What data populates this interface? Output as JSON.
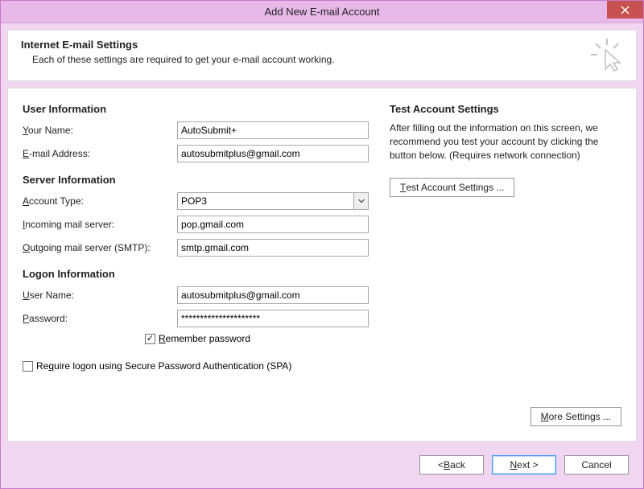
{
  "window": {
    "title": "Add New E-mail Account"
  },
  "header": {
    "title": "Internet E-mail Settings",
    "subtitle": "Each of these settings are required to get your e-mail account working."
  },
  "sections": {
    "user_info": "User Information",
    "server_info": "Server Information",
    "logon_info": "Logon Information",
    "test_settings": "Test Account Settings"
  },
  "labels": {
    "your_name": {
      "pre": "",
      "u": "Y",
      "post": "our Name:"
    },
    "email": {
      "pre": "",
      "u": "E",
      "post": "-mail Address:"
    },
    "account_type": {
      "pre": "",
      "u": "A",
      "post": "ccount Type:"
    },
    "incoming": {
      "pre": "",
      "u": "I",
      "post": "ncoming mail server:"
    },
    "outgoing": {
      "pre": "",
      "u": "O",
      "post": "utgoing mail server (SMTP):"
    },
    "user_name": {
      "pre": "",
      "u": "U",
      "post": "ser Name:"
    },
    "password": {
      "pre": "",
      "u": "P",
      "post": "assword:"
    },
    "remember": {
      "pre": "",
      "u": "R",
      "post": "emember password"
    },
    "spa": {
      "pre": "Re",
      "u": "q",
      "post": "uire logon using Secure Password Authentication (SPA)"
    }
  },
  "values": {
    "your_name": "AutoSubmit+",
    "email": "autosubmitplus@gmail.com",
    "account_type": "POP3",
    "incoming": "pop.gmail.com",
    "outgoing": "smtp.gmail.com",
    "user_name": "autosubmitplus@gmail.com",
    "password": "*********************",
    "remember_checked": true,
    "spa_checked": false
  },
  "right": {
    "text": "After filling out the information on this screen, we recommend you test your account by clicking the button below. (Requires network connection)",
    "test_btn": {
      "pre": "",
      "u": "T",
      "post": "est Account Settings ..."
    },
    "more_btn": {
      "pre": "",
      "u": "M",
      "post": "ore Settings ..."
    }
  },
  "footer": {
    "back": {
      "pre": "< ",
      "u": "B",
      "post": "ack"
    },
    "next": {
      "pre": "",
      "u": "N",
      "post": "ext >"
    },
    "cancel": "Cancel"
  }
}
